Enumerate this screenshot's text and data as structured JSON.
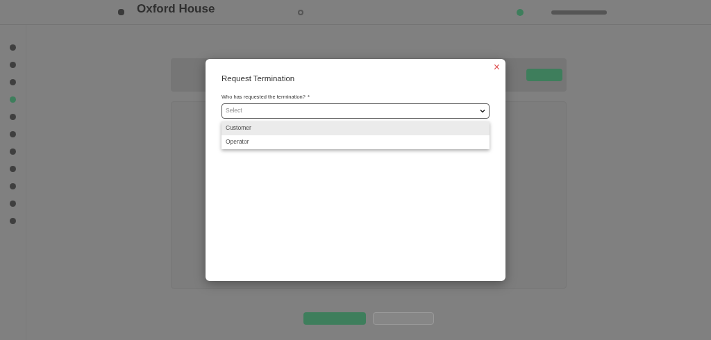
{
  "page": {
    "title": "Oxford House"
  },
  "dialog": {
    "title": "Request Termination",
    "close": "×",
    "field": {
      "label": "Who has requested the termination?",
      "required_mark": "*",
      "placeholder": "Select",
      "expanded": true,
      "options": [
        {
          "label": "Customer",
          "selected": true
        },
        {
          "label": "Operator",
          "selected": false
        }
      ]
    }
  }
}
